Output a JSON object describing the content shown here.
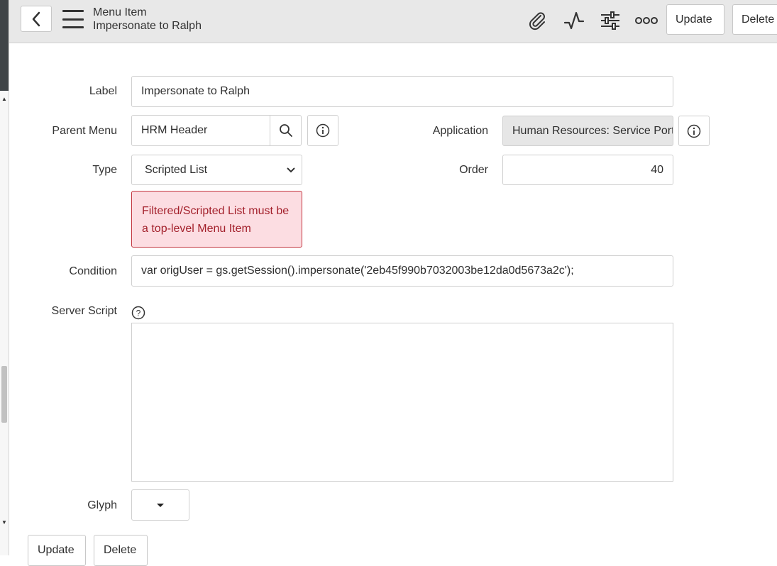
{
  "header": {
    "title": "Menu Item",
    "subtitle": "Impersonate to Ralph",
    "icons": [
      "chevron-left-icon",
      "hamburger-icon",
      "paperclip-icon",
      "activity-icon",
      "sliders-icon",
      "more-icon"
    ],
    "update_label": "Update",
    "delete_label": "Delete"
  },
  "form": {
    "label": {
      "caption": "Label",
      "value": "Impersonate to  Ralph"
    },
    "parent_menu": {
      "caption": "Parent Menu",
      "value": "HRM Header"
    },
    "application": {
      "caption": "Application",
      "value": "Human Resources: Service Portal"
    },
    "type": {
      "caption": "Type",
      "value": "Scripted List"
    },
    "order": {
      "caption": "Order",
      "value": "40"
    },
    "error_message": "Filtered/Scripted List must be a top-level Menu Item",
    "condition": {
      "caption": "Condition",
      "value": "var origUser = gs.getSession().impersonate('2eb45f990b7032003be12da0d5673a2c');"
    },
    "server_script": {
      "caption": "Server Script",
      "value": ""
    },
    "glyph": {
      "caption": "Glyph"
    }
  },
  "footer": {
    "update_label": "Update",
    "delete_label": "Delete"
  },
  "colors": {
    "error_bg": "#fcdde2",
    "error_border": "#c2353f",
    "error_text": "#a3202b",
    "header_bg": "#e8e8e8"
  }
}
